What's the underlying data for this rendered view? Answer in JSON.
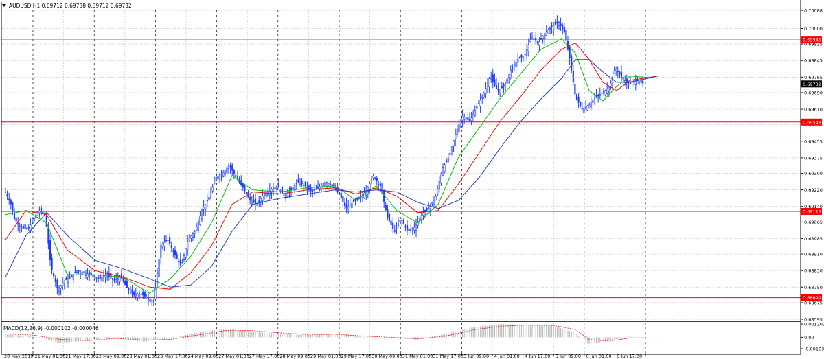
{
  "header": {
    "symbol_line": "AUDUSD,H1  0.69712 0.69738 0.69712 0.69732",
    "macd_line": "MACD(12,26,9) -0.000102 -0.000046"
  },
  "colors": {
    "background": "#ffffff",
    "candles": "#1e3cff",
    "grid": "#c8c8c8",
    "sr_lines": "#ff0000",
    "sr_label_bg": "#ff0000",
    "price_label_bg": "#000000",
    "ma_fast": "#00c000",
    "ma_mid": "#ff0000",
    "ma_slow": "#1e3cd2",
    "macd_hist": "#b4b4b4",
    "macd_signal": "#ff0000"
  },
  "chart_data": {
    "type": "candlestick",
    "symbol": "AUDUSD",
    "timeframe": "H1",
    "ylim": [
      0.68595,
      0.70088
    ],
    "y_ticks": [
      "0.70088",
      "0.70000",
      "0.69925",
      "0.69845",
      "0.69765",
      "0.69690",
      "0.69610",
      "0.69535",
      "0.69455",
      "0.69375",
      "0.69300",
      "0.69220",
      "0.69140",
      "0.69065",
      "0.68985",
      "0.68910",
      "0.68830",
      "0.68750",
      "0.68675",
      "0.68595"
    ],
    "x_labels": [
      "20 May 2019",
      "21 May 01:00",
      "21 May 17:00",
      "22 May 09:00",
      "23 May 01:00",
      "23 May 17:00",
      "24 May 09:00",
      "27 May 01:00",
      "27 May 17:00",
      "28 May 09:00",
      "29 May 01:00",
      "29 May 17:00",
      "30 May 09:00",
      "31 May 01:00",
      "31 May 17:00",
      "3 Jun 09:00",
      "4 Jun 01:00",
      "4 Jun 17:00",
      "5 Jun 09:00",
      "6 Jun 01:00",
      "6 Jun 17:00"
    ],
    "close_path": [
      [
        0,
        0.6921
      ],
      [
        8,
        0.6915
      ],
      [
        13,
        0.6908
      ],
      [
        22,
        0.6904
      ],
      [
        33,
        0.6903
      ],
      [
        48,
        0.6912
      ],
      [
        58,
        0.691
      ],
      [
        66,
        0.6885
      ],
      [
        76,
        0.6874
      ],
      [
        86,
        0.6878
      ],
      [
        96,
        0.688
      ],
      [
        103,
        0.6883
      ],
      [
        113,
        0.6882
      ],
      [
        125,
        0.6881
      ],
      [
        136,
        0.6879
      ],
      [
        148,
        0.6881
      ],
      [
        158,
        0.6878
      ],
      [
        168,
        0.688
      ],
      [
        176,
        0.6875
      ],
      [
        186,
        0.6871
      ],
      [
        196,
        0.6872
      ],
      [
        206,
        0.687
      ],
      [
        216,
        0.6868
      ],
      [
        226,
        0.6895
      ],
      [
        236,
        0.6898
      ],
      [
        246,
        0.6891
      ],
      [
        256,
        0.6885
      ],
      [
        266,
        0.6898
      ],
      [
        276,
        0.6902
      ],
      [
        286,
        0.6912
      ],
      [
        296,
        0.6918
      ],
      [
        306,
        0.6928
      ],
      [
        316,
        0.693
      ],
      [
        326,
        0.6934
      ],
      [
        336,
        0.6928
      ],
      [
        346,
        0.6923
      ],
      [
        356,
        0.6917
      ],
      [
        366,
        0.6915
      ],
      [
        376,
        0.692
      ],
      [
        386,
        0.6922
      ],
      [
        396,
        0.6924
      ],
      [
        406,
        0.6919
      ],
      [
        416,
        0.6922
      ],
      [
        426,
        0.6926
      ],
      [
        436,
        0.6924
      ],
      [
        446,
        0.6921
      ],
      [
        456,
        0.6923
      ],
      [
        466,
        0.6926
      ],
      [
        476,
        0.6924
      ],
      [
        486,
        0.692
      ],
      [
        496,
        0.6913
      ],
      [
        506,
        0.6916
      ],
      [
        516,
        0.6918
      ],
      [
        526,
        0.6922
      ],
      [
        536,
        0.6929
      ],
      [
        546,
        0.6924
      ],
      [
        556,
        0.6909
      ],
      [
        566,
        0.6902
      ],
      [
        576,
        0.6908
      ],
      [
        586,
        0.6902
      ],
      [
        596,
        0.6904
      ],
      [
        606,
        0.691
      ],
      [
        616,
        0.6913
      ],
      [
        626,
        0.6918
      ],
      [
        636,
        0.6932
      ],
      [
        646,
        0.6938
      ],
      [
        656,
        0.695
      ],
      [
        666,
        0.6958
      ],
      [
        676,
        0.6955
      ],
      [
        686,
        0.6962
      ],
      [
        696,
        0.6968
      ],
      [
        706,
        0.6977
      ],
      [
        716,
        0.697
      ],
      [
        726,
        0.6972
      ],
      [
        736,
        0.698
      ],
      [
        746,
        0.6985
      ],
      [
        756,
        0.6987
      ],
      [
        766,
        0.6996
      ],
      [
        776,
        0.6993
      ],
      [
        786,
        0.6998
      ],
      [
        796,
        0.7001
      ],
      [
        806,
        0.7003
      ],
      [
        814,
        0.6998
      ],
      [
        822,
        0.6985
      ],
      [
        830,
        0.6967
      ],
      [
        840,
        0.6961
      ],
      [
        850,
        0.6963
      ],
      [
        860,
        0.6967
      ],
      [
        870,
        0.6969
      ],
      [
        880,
        0.6972
      ],
      [
        888,
        0.6981
      ],
      [
        898,
        0.6976
      ],
      [
        908,
        0.6973
      ],
      [
        918,
        0.6975
      ],
      [
        930,
        0.69732
      ]
    ],
    "moving_averages": [
      {
        "color": "#00c000",
        "points": [
          [
            0,
            0.691
          ],
          [
            30,
            0.6912
          ],
          [
            60,
            0.6906
          ],
          [
            90,
            0.6881
          ],
          [
            130,
            0.6881
          ],
          [
            170,
            0.688
          ],
          [
            210,
            0.6872
          ],
          [
            240,
            0.6879
          ],
          [
            270,
            0.689
          ],
          [
            300,
            0.6906
          ],
          [
            330,
            0.6929
          ],
          [
            360,
            0.6922
          ],
          [
            400,
            0.6921
          ],
          [
            440,
            0.6923
          ],
          [
            480,
            0.6924
          ],
          [
            510,
            0.6917
          ],
          [
            540,
            0.6924
          ],
          [
            570,
            0.6912
          ],
          [
            600,
            0.6906
          ],
          [
            630,
            0.6915
          ],
          [
            660,
            0.6938
          ],
          [
            690,
            0.6952
          ],
          [
            720,
            0.6966
          ],
          [
            750,
            0.6978
          ],
          [
            780,
            0.699
          ],
          [
            810,
            0.6995
          ],
          [
            830,
            0.6988
          ],
          [
            850,
            0.697
          ],
          [
            870,
            0.6965
          ],
          [
            890,
            0.6972
          ],
          [
            910,
            0.6977
          ],
          [
            950,
            0.6976
          ]
        ]
      },
      {
        "color": "#ff0000",
        "points": [
          [
            0,
            0.6898
          ],
          [
            30,
            0.6912
          ],
          [
            60,
            0.691
          ],
          [
            90,
            0.6893
          ],
          [
            130,
            0.6883
          ],
          [
            170,
            0.688
          ],
          [
            210,
            0.6875
          ],
          [
            240,
            0.6874
          ],
          [
            270,
            0.6882
          ],
          [
            300,
            0.6895
          ],
          [
            330,
            0.6915
          ],
          [
            360,
            0.6921
          ],
          [
            400,
            0.692
          ],
          [
            440,
            0.6922
          ],
          [
            480,
            0.6923
          ],
          [
            510,
            0.692
          ],
          [
            540,
            0.6923
          ],
          [
            570,
            0.6919
          ],
          [
            600,
            0.6911
          ],
          [
            630,
            0.6912
          ],
          [
            660,
            0.6925
          ],
          [
            690,
            0.694
          ],
          [
            720,
            0.6955
          ],
          [
            750,
            0.6967
          ],
          [
            780,
            0.698
          ],
          [
            810,
            0.699
          ],
          [
            830,
            0.6993
          ],
          [
            850,
            0.6985
          ],
          [
            870,
            0.6974
          ],
          [
            890,
            0.697
          ],
          [
            910,
            0.6975
          ],
          [
            950,
            0.6977
          ]
        ]
      },
      {
        "color": "#1e3cd2",
        "points": [
          [
            0,
            0.688
          ],
          [
            30,
            0.69
          ],
          [
            60,
            0.6911
          ],
          [
            90,
            0.69
          ],
          [
            130,
            0.6888
          ],
          [
            170,
            0.6884
          ],
          [
            210,
            0.6879
          ],
          [
            240,
            0.6875
          ],
          [
            270,
            0.6876
          ],
          [
            300,
            0.6885
          ],
          [
            330,
            0.6902
          ],
          [
            360,
            0.6915
          ],
          [
            400,
            0.6918
          ],
          [
            440,
            0.692
          ],
          [
            480,
            0.6922
          ],
          [
            510,
            0.6921
          ],
          [
            540,
            0.6922
          ],
          [
            570,
            0.6921
          ],
          [
            600,
            0.6916
          ],
          [
            630,
            0.6913
          ],
          [
            660,
            0.6917
          ],
          [
            690,
            0.6928
          ],
          [
            720,
            0.6942
          ],
          [
            750,
            0.6955
          ],
          [
            780,
            0.6966
          ],
          [
            810,
            0.6976
          ],
          [
            830,
            0.6985
          ],
          [
            850,
            0.6985
          ],
          [
            870,
            0.6979
          ],
          [
            890,
            0.6974
          ],
          [
            910,
            0.6974
          ],
          [
            950,
            0.6977
          ]
        ]
      }
    ],
    "sr_levels": [
      {
        "value": 0.69945,
        "label": "0.69945"
      },
      {
        "value": 0.69548,
        "label": "0.69548"
      },
      {
        "value": 0.69116,
        "label": "0.69116"
      },
      {
        "value": 0.68699,
        "label": "0.68699"
      }
    ],
    "current_price": {
      "value": 0.69732,
      "label": "0.69732"
    },
    "macd": {
      "ylim": [
        -0.001032,
        0.001202
      ],
      "y_ticks": [
        "0.001202",
        "0.00",
        "-0.001032"
      ],
      "hist_path": [
        [
          0,
          0.00025
        ],
        [
          40,
          0.0001
        ],
        [
          80,
          -0.0005
        ],
        [
          120,
          -0.0003
        ],
        [
          160,
          0.0
        ],
        [
          200,
          -0.0004
        ],
        [
          240,
          -0.0001
        ],
        [
          280,
          0.00045
        ],
        [
          320,
          0.0008
        ],
        [
          360,
          0.0005
        ],
        [
          400,
          0.0003
        ],
        [
          440,
          0.0002
        ],
        [
          480,
          0.0003
        ],
        [
          520,
          5e-05
        ],
        [
          560,
          -5e-05
        ],
        [
          600,
          -0.0002
        ],
        [
          640,
          0.0003
        ],
        [
          680,
          0.0009
        ],
        [
          720,
          0.0012
        ],
        [
          760,
          0.0011
        ],
        [
          800,
          0.001
        ],
        [
          830,
          0.0004
        ],
        [
          850,
          -0.0006
        ],
        [
          880,
          -0.0003
        ],
        [
          910,
          0.0001
        ],
        [
          930,
          -0.0001
        ]
      ],
      "signal_path": [
        [
          0,
          0.0003
        ],
        [
          40,
          0.0002
        ],
        [
          80,
          -0.0002
        ],
        [
          120,
          -0.0003
        ],
        [
          160,
          -0.0001
        ],
        [
          200,
          -0.00025
        ],
        [
          240,
          -0.0002
        ],
        [
          280,
          0.0002
        ],
        [
          320,
          0.0006
        ],
        [
          360,
          0.0006
        ],
        [
          400,
          0.0004
        ],
        [
          440,
          0.00025
        ],
        [
          480,
          0.00028
        ],
        [
          520,
          0.00012
        ],
        [
          560,
          0.0
        ],
        [
          600,
          -0.00015
        ],
        [
          640,
          0.0001
        ],
        [
          680,
          0.00065
        ],
        [
          720,
          0.001
        ],
        [
          760,
          0.0011
        ],
        [
          800,
          0.00105
        ],
        [
          830,
          0.0007
        ],
        [
          850,
          -0.0002
        ],
        [
          880,
          -0.00035
        ],
        [
          910,
          -5e-05
        ],
        [
          930,
          -5e-05
        ]
      ]
    }
  }
}
